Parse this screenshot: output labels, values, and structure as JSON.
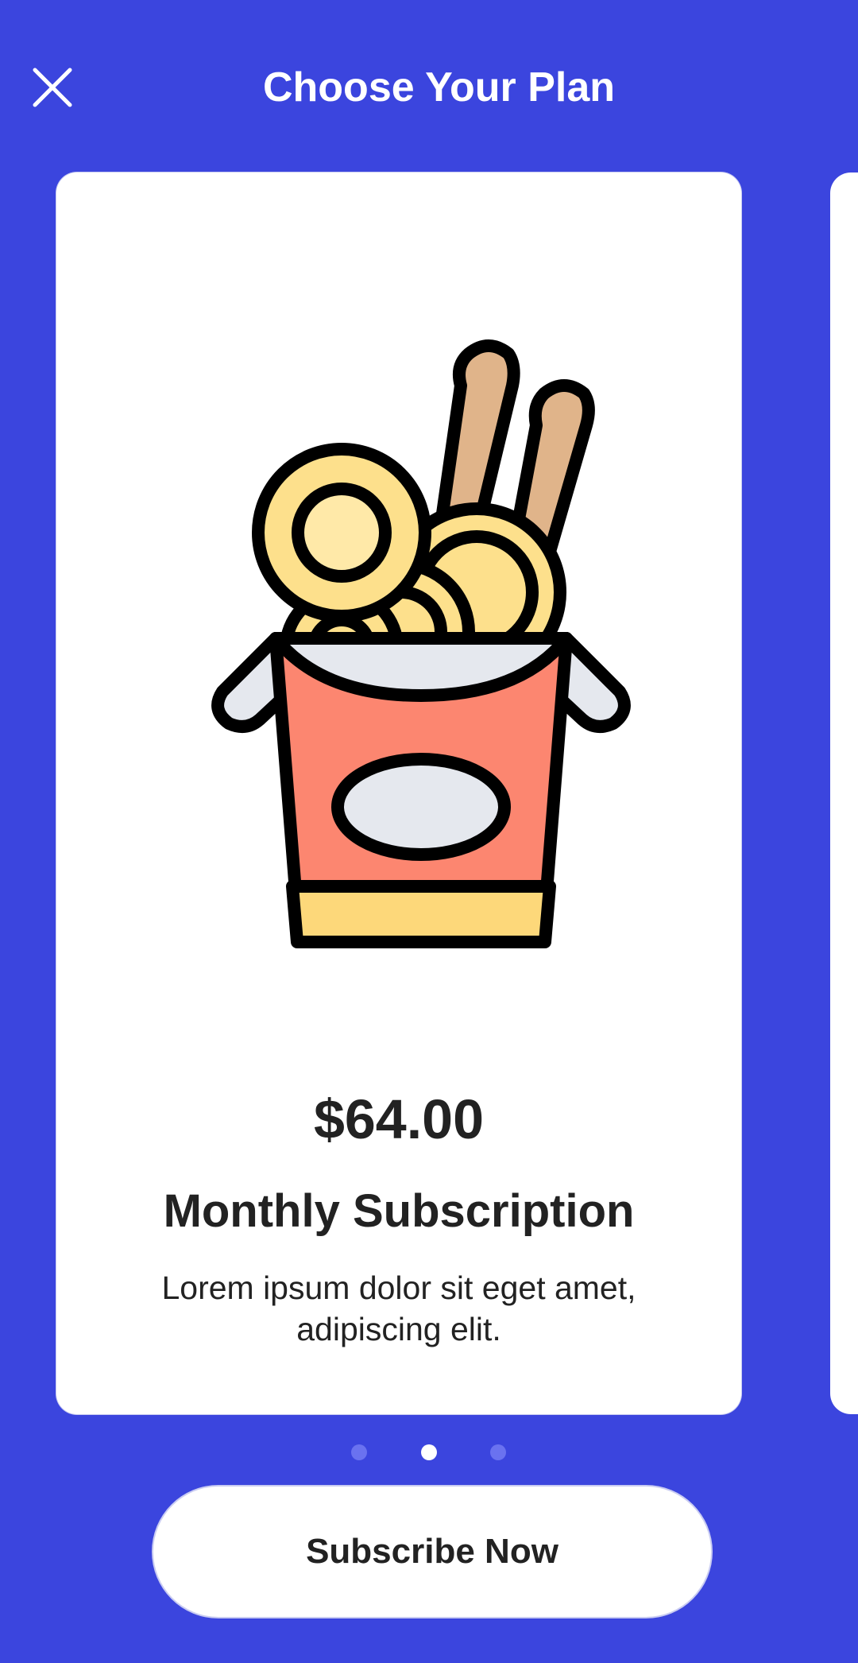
{
  "header": {
    "title": "Choose Your Plan",
    "close_icon": "close-icon"
  },
  "plan": {
    "illustration": "noodle-box-icon",
    "price": "$64.00",
    "name": "Monthly Subscription",
    "description": "Lorem ipsum dolor sit eget amet, adipiscing elit."
  },
  "pager": {
    "total": 3,
    "active_index": 1
  },
  "cta": {
    "label": "Subscribe Now"
  },
  "colors": {
    "background": "#3b45de",
    "card": "#ffffff",
    "text": "#222222",
    "dot_inactive": "#6a72f0",
    "dot_active": "#ffffff"
  }
}
